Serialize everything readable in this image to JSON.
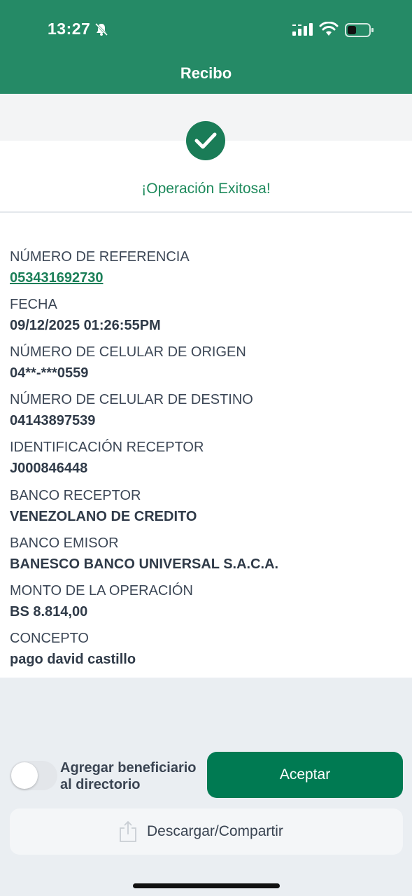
{
  "status_bar": {
    "time": "13:27",
    "icons": [
      "bell-off-icon",
      "signal-icon",
      "wifi-icon",
      "battery-icon"
    ]
  },
  "header": {
    "title": "Recibo"
  },
  "success": {
    "message": "¡Operación Exitosa!",
    "icon": "check-circle-icon"
  },
  "details": [
    {
      "label": "NÚMERO DE REFERENCIA",
      "value": "053431692730"
    },
    {
      "label": "FECHA",
      "value": "09/12/2025 01:26:55PM"
    },
    {
      "label": "NÚMERO DE CELULAR DE ORIGEN",
      "value": "04**-***0559"
    },
    {
      "label": "NÚMERO DE CELULAR DE DESTINO",
      "value": "04143897539"
    },
    {
      "label": "IDENTIFICACIÓN RECEPTOR",
      "value": "J000846448"
    },
    {
      "label": "BANCO RECEPTOR",
      "value": "VENEZOLANO DE CREDITO"
    },
    {
      "label": "BANCO EMISOR",
      "value": "BANESCO BANCO UNIVERSAL S.A.C.A."
    },
    {
      "label": "MONTO DE LA OPERACIÓN",
      "value": "BS 8.814,00"
    },
    {
      "label": "CONCEPTO",
      "value": "pago david castillo"
    }
  ],
  "actions": {
    "toggle_label_line1": "Agregar beneficiario",
    "toggle_label_line2": "al directorio",
    "toggle_on": false,
    "accept_label": "Aceptar",
    "download_label": "Descargar/Compartir"
  },
  "colors": {
    "brand": "#258a66",
    "accent": "#007a52",
    "success_text": "#1e8a5c"
  }
}
